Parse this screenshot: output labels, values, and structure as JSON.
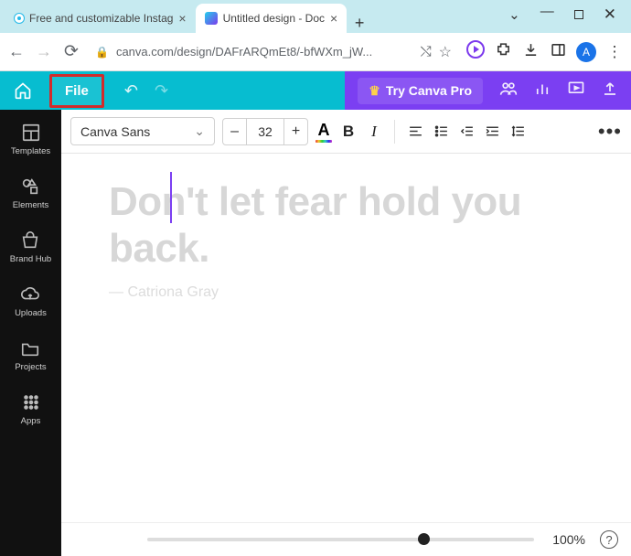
{
  "browser": {
    "tabs": [
      {
        "label": "Free and customizable Instag",
        "active": false
      },
      {
        "label": "Untitled design - Doc",
        "active": true
      }
    ],
    "url": "canva.com/design/DAFrARQmEt8/-bfWXm_jW...",
    "avatar_initial": "A"
  },
  "app_top": {
    "file_label": "File",
    "try_pro_label": "Try Canva Pro"
  },
  "sidebar": {
    "items": [
      {
        "id": "templates",
        "label": "Templates"
      },
      {
        "id": "elements",
        "label": "Elements"
      },
      {
        "id": "brandhub",
        "label": "Brand Hub"
      },
      {
        "id": "uploads",
        "label": "Uploads"
      },
      {
        "id": "projects",
        "label": "Projects"
      },
      {
        "id": "apps",
        "label": "Apps"
      }
    ]
  },
  "toolbar": {
    "font_name": "Canva Sans",
    "font_size": "32",
    "minus": "–",
    "plus": "+",
    "color_letter": "A",
    "bold": "B",
    "italic": "I",
    "more": "•••"
  },
  "document": {
    "headline": "Don't let fear hold you back.",
    "byline": "— Catriona Gray"
  },
  "footer": {
    "zoom_label": "100%",
    "help": "?"
  }
}
